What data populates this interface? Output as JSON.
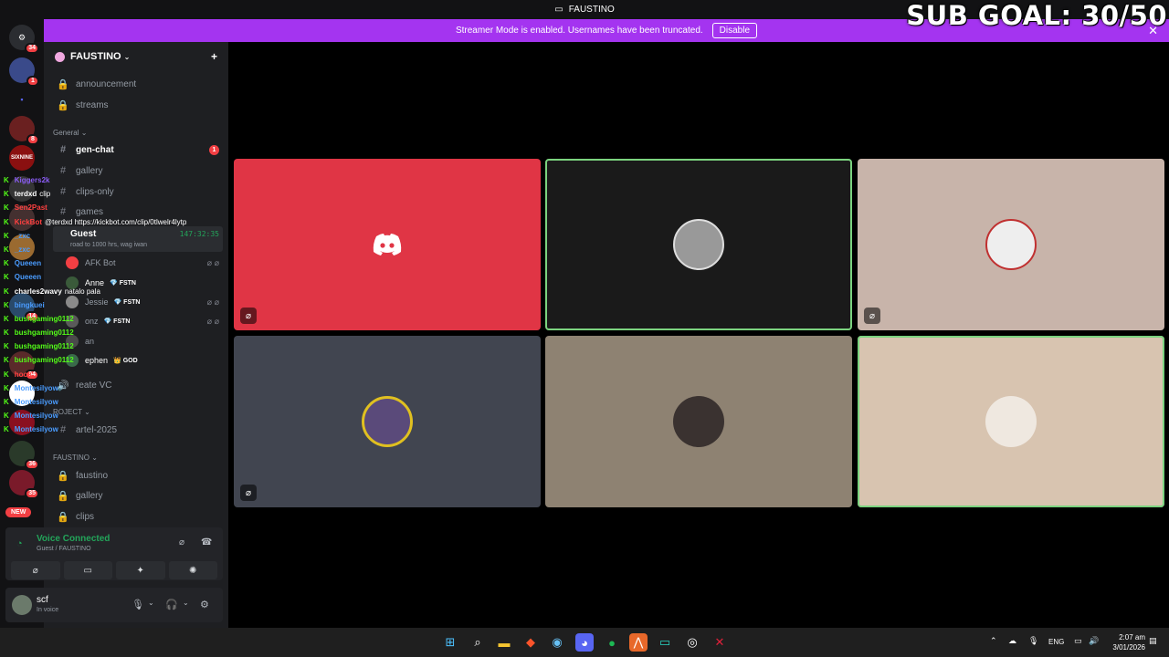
{
  "titlebar": {
    "title": "FAUSTINO"
  },
  "overlay": {
    "sub_goal": "SUB GOAL: 30/50"
  },
  "banner": {
    "text": "Streamer Mode is enabled. Usernames have been truncated.",
    "button": "Disable",
    "close": "✕"
  },
  "rail": {
    "servers": [
      {
        "label": "⚙",
        "badge": "34"
      },
      {
        "label": "",
        "badge": "1"
      },
      {
        "label": "▪",
        "badge": ""
      },
      {
        "label": "",
        "badge": "8"
      },
      {
        "label": "SIXNINE",
        "badge": ""
      },
      {
        "label": "",
        "badge": ""
      },
      {
        "label": "",
        "badge": ""
      },
      {
        "label": "",
        "badge": ""
      },
      {
        "label": "",
        "badge": "14"
      },
      {
        "label": "",
        "badge": "94"
      },
      {
        "label": "",
        "badge": ""
      },
      {
        "label": "",
        "badge": ""
      },
      {
        "label": "",
        "badge": "36"
      },
      {
        "label": "",
        "badge": "35"
      }
    ],
    "new_label": "NEW"
  },
  "sidebar": {
    "server_name": "FAUSTINO",
    "channels_top": [
      {
        "icon": "🔒",
        "name": "announcement"
      },
      {
        "icon": "🔒",
        "name": "streams"
      }
    ],
    "category_general": "General",
    "channels_general": [
      {
        "icon": "#",
        "name": "gen-chat",
        "unread": "1"
      },
      {
        "icon": "#",
        "name": "gallery"
      },
      {
        "icon": "#",
        "name": "clips-only"
      },
      {
        "icon": "#",
        "name": "games"
      }
    ],
    "guest": {
      "name": "Guest",
      "sub": "road to 1000 hrs, wag iwan",
      "timer": "147:32:35"
    },
    "voice_users": [
      {
        "name": "AFK Bot",
        "tag": "",
        "icons": "⌀ ⌀"
      },
      {
        "name": "Anne",
        "tag": "💎 FSTN",
        "icons": ""
      },
      {
        "name": "Jessie",
        "tag": "💎 FSTN",
        "icons": "⌀ ⌀"
      },
      {
        "name": "onz",
        "tag": "💎 FSTN",
        "icons": "⌀ ⌀"
      },
      {
        "name": "an",
        "tag": "",
        "icons": ""
      },
      {
        "name": "ephen",
        "tag": "👑 GOD",
        "icons": ""
      }
    ],
    "create_vc": "reate VC",
    "category_project": "ROJECT",
    "channel_project": "artel-2025",
    "category_faustino": "FAUSTINO",
    "channels_faustino": [
      {
        "icon": "🔒",
        "name": "faustino"
      },
      {
        "icon": "🔒",
        "name": "gallery"
      },
      {
        "icon": "🔒",
        "name": "clips"
      }
    ]
  },
  "voice_panel": {
    "title": "Voice Connected",
    "sub": "Guest / FAUSTINO"
  },
  "user_panel": {
    "name": "scf",
    "status": "In voice"
  },
  "chat_overlay": [
    {
      "user": "Kiggers2k",
      "color": "#8a5cf5",
      "text": ""
    },
    {
      "user": "terdxd",
      "color": "#ffffff",
      "text": "clip"
    },
    {
      "user": "Sen2Past",
      "color": "#ff4040",
      "text": ""
    },
    {
      "user": "KickBot",
      "color": "#53fc18",
      "text": "@terdxd https://kickbot.com/clip/0tlwelr4lytp"
    },
    {
      "user": "_zxc",
      "color": "#4a9cff",
      "text": ""
    },
    {
      "user": "_zxc",
      "color": "#4a9cff",
      "text": ""
    },
    {
      "user": "Queeen",
      "color": "#4a9cff",
      "text": ""
    },
    {
      "user": "Queeen",
      "color": "#4a9cff",
      "text": ""
    },
    {
      "user": "charles2wavy",
      "color": "#ffffff",
      "text": "natalo pala"
    },
    {
      "user": "bingkuei",
      "color": "#4a9cff",
      "text": ""
    },
    {
      "user": "bushgaming0112",
      "color": "#53fc18",
      "text": ""
    },
    {
      "user": "bushgaming0112",
      "color": "#53fc18",
      "text": ""
    },
    {
      "user": "bushgaming0112",
      "color": "#53fc18",
      "text": ""
    },
    {
      "user": "bushgaming0112",
      "color": "#53fc18",
      "text": ""
    },
    {
      "user": "hook",
      "color": "#ff4040",
      "text": ""
    },
    {
      "user": "Montesilyow",
      "color": "#4a9cff",
      "text": ""
    },
    {
      "user": "Montesilyow",
      "color": "#4a9cff",
      "text": ""
    },
    {
      "user": "Montesilyow",
      "color": "#4a9cff",
      "text": ""
    },
    {
      "user": "Montesilyow",
      "color": "#4a9cff",
      "text": ""
    }
  ],
  "tiles": [
    {
      "bg": "#e03545",
      "avatar": "discord-logo",
      "speaking": false,
      "state": true
    },
    {
      "bg": "#1a1a1a",
      "avatar": "user-photo",
      "speaking": true,
      "state": false
    },
    {
      "bg": "#c8b4aa",
      "avatar": "user-photo",
      "speaking": false,
      "state": true
    },
    {
      "bg": "#414550",
      "avatar": "cartoon-avatar",
      "speaking": false,
      "state": true
    },
    {
      "bg": "#8e8272",
      "avatar": "user-photo",
      "speaking": false,
      "state": false
    },
    {
      "bg": "#d8c4b0",
      "avatar": "user-photo",
      "speaking": true,
      "state": false
    }
  ],
  "taskbar": {
    "tray": {
      "lang": "ENG"
    },
    "time": "2:07 am",
    "date": "3/01/2026"
  }
}
